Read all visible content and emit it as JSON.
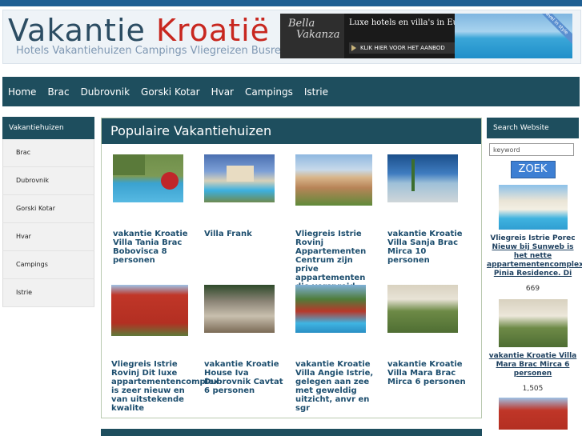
{
  "header": {
    "title_part1": "Vakantie",
    "title_part2": "Kroatië",
    "subtitle": "Hotels Vakantiehuizen Campings Vliegreizen Busreizen",
    "banner": {
      "brand_line1": "Bella",
      "brand_line2": "Vakanza",
      "tagline": "Luxe hotels en villa's in Europa",
      "cta": "KLIK HIER VOOR HET AANBOD",
      "ribbon": "Travel in style"
    }
  },
  "nav": {
    "items": [
      "Home",
      "Brac",
      "Dubrovnik",
      "Gorski Kotar",
      "Hvar",
      "Campings",
      "Istrie"
    ]
  },
  "sidebar": {
    "title": "Vakantiehuizen",
    "items": [
      "Brac",
      "Dubrovnik",
      "Gorski Kotar",
      "Hvar",
      "Campings",
      "Istrie"
    ]
  },
  "main": {
    "title": "Populaire Vakantiehuizen",
    "cards": [
      {
        "title": "vakantie Kroatie Villa Tania Brac Bobovisca 8 personen"
      },
      {
        "title": "Villa Frank"
      },
      {
        "title": "Vliegreis Istrie Rovinj Appartementen Centrum zijn prive appartementen die verspreid"
      },
      {
        "title": "vakantie Kroatie Villa Sanja Brac Mirca 10 personen"
      },
      {
        "title": "Vliegreis Istrie Rovinj Dit luxe appartementencomplex is zeer nieuw en van uitstekende kwalite"
      },
      {
        "title": "vakantie Kroatie House Iva Dubrovnik Cavtat 6 personen"
      },
      {
        "title": "vakantie Kroatie Villa Angie Istrie, gelegen aan zee met geweldig uitzicht, anvr en sgr"
      },
      {
        "title": "vakantie Kroatie Villa Mara Brac Mirca 6 personen"
      }
    ]
  },
  "search": {
    "title": "Search Website",
    "placeholder": "keyword",
    "button": "ZOEK",
    "results": [
      {
        "title": "Vliegreis Istrie Porec",
        "desc": "Nieuw bij Sunweb is het nette appartementencomplex Pinia Residence. Di",
        "count": "669"
      },
      {
        "title": "",
        "desc": "vakantie Kroatie Villa Mara Brac Mirca 6 personen",
        "count": "1,505"
      }
    ]
  }
}
